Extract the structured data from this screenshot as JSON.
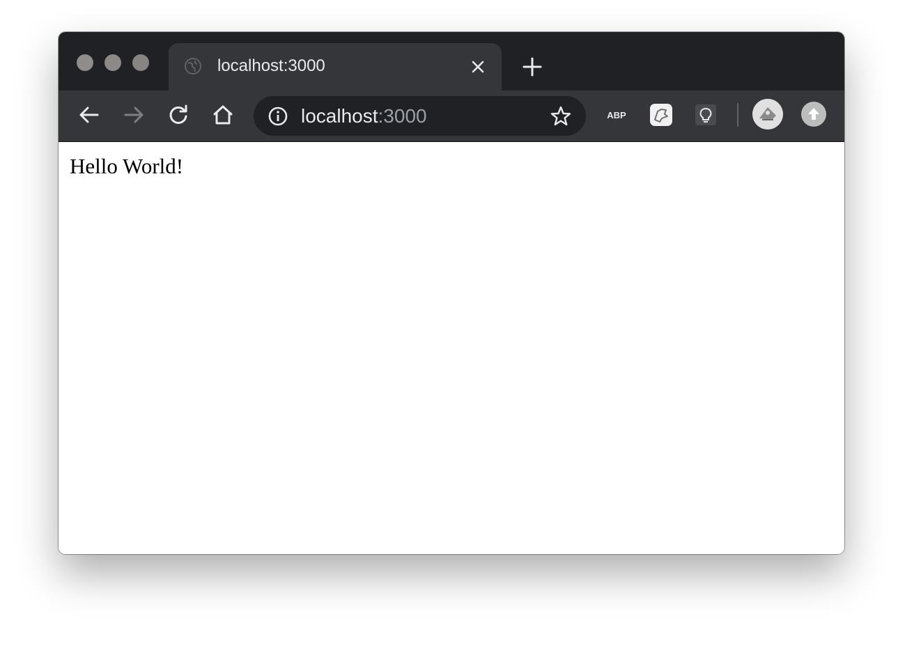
{
  "window": {
    "traffic_lights": [
      "close",
      "minimize",
      "zoom"
    ]
  },
  "tab": {
    "title": "localhost:3000",
    "favicon": "globe-icon",
    "close_icon": "close-icon"
  },
  "new_tab_icon": "plus-icon",
  "toolbar": {
    "back_icon": "arrow-left-icon",
    "forward_icon": "arrow-right-icon",
    "reload_icon": "reload-icon",
    "home_icon": "home-icon",
    "omnibox": {
      "info_icon": "info-icon",
      "host": "localhost",
      "port": ":3000",
      "bookmark_icon": "star-icon"
    },
    "extensions": [
      {
        "name": "adblock-plus-extension",
        "label": "ABP"
      },
      {
        "name": "puzzle-extension",
        "icon": "puzzle-icon"
      },
      {
        "name": "lightbulb-extension",
        "icon": "lightbulb-icon"
      }
    ],
    "profile_icon": "avatar",
    "update_icon": "update-arrow-icon"
  },
  "page": {
    "text": "Hello World!"
  },
  "colors": {
    "titlebar": "#202124",
    "tab": "#35363a",
    "omnibox": "#202124",
    "text": "#e8eaed",
    "port_text": "#9aa0a6"
  }
}
